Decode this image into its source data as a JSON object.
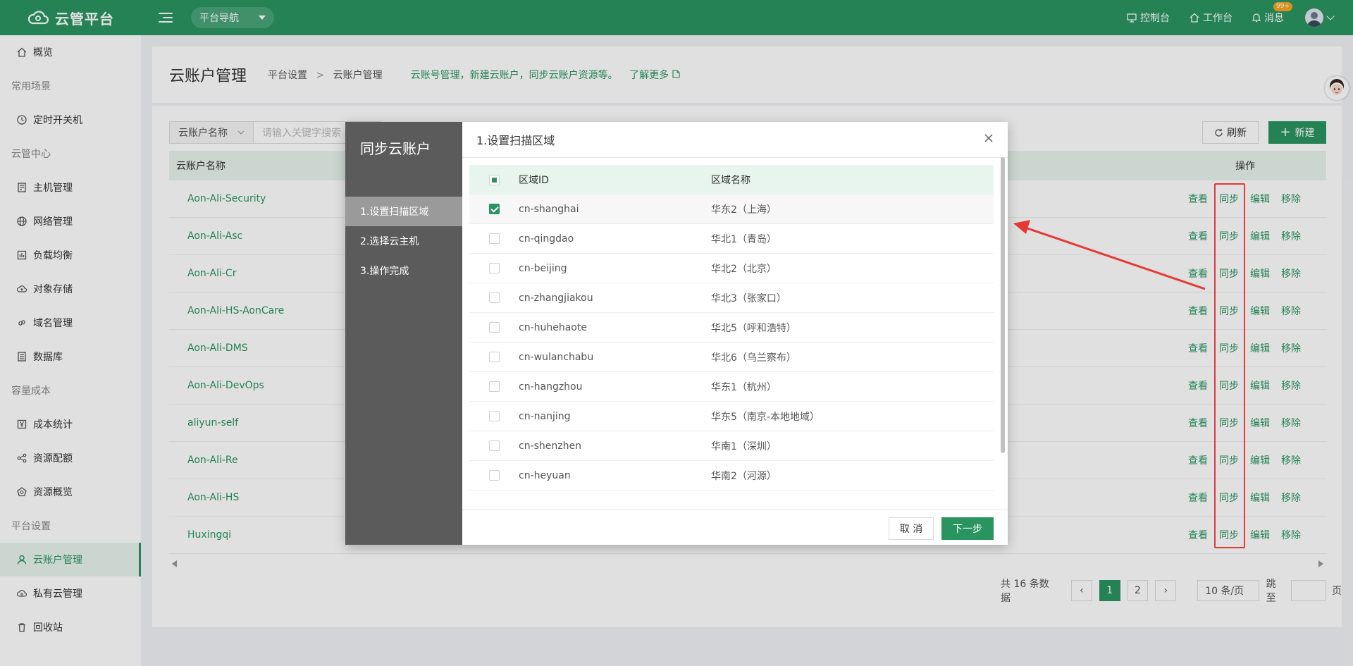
{
  "header": {
    "brand": "云管平台",
    "nav_label": "平台导航",
    "right": [
      {
        "icon": "monitor-icon",
        "label": "控制台"
      },
      {
        "icon": "home-icon",
        "label": "工作台"
      },
      {
        "icon": "bell-icon",
        "label": "消息"
      }
    ],
    "msg_badge": "99+"
  },
  "sidebar": {
    "overview": "概览",
    "group1": "常用场景",
    "timer": "定时开关机",
    "group2": "云管中心",
    "hosts": "主机管理",
    "network": "网络管理",
    "lb": "负载均衡",
    "oss": "对象存储",
    "dns": "域名管理",
    "db": "数据库",
    "group3": "容量成本",
    "cost": "成本统计",
    "quota": "资源配额",
    "res_overview": "资源概览",
    "group4": "平台设置",
    "cloud_account": "云账户管理",
    "private_cloud": "私有云管理",
    "recycle": "回收站"
  },
  "page": {
    "title": "云账户管理",
    "crumb1": "平台设置",
    "crumb_sep": ">",
    "crumb2": "云账户管理",
    "desc": "云账号管理，新建云账户，同步云账户资源等。",
    "more": "了解更多"
  },
  "toolbar": {
    "filter_select": "云账户名称",
    "search_placeholder": "请输入关键字搜索",
    "refresh": "刷新",
    "new": "新建"
  },
  "table": {
    "col_name": "云账户名称",
    "col_op": "操作",
    "rows": [
      "Aon-Ali-Security",
      "Aon-Ali-Asc",
      "Aon-Ali-Cr",
      "Aon-Ali-HS-AonCare",
      "Aon-Ali-DMS",
      "Aon-Ali-DevOps",
      "aliyun-self",
      "Aon-Ali-Re",
      "Aon-Ali-HS",
      "Huxingqi"
    ],
    "ops": {
      "view": "查看",
      "sync": "同步",
      "edit": "编辑",
      "remove": "移除"
    }
  },
  "pager": {
    "total": "共 16 条数据",
    "pages": [
      "1",
      "2"
    ],
    "size": "10 条/页",
    "goto": "跳至",
    "unit": "页"
  },
  "modal": {
    "title": "同步云账户",
    "steps": [
      "1.设置扫描区域",
      "2.选择云主机",
      "3.操作完成"
    ],
    "step_title": "1.设置扫描区域",
    "col_id": "区域ID",
    "col_name": "区域名称",
    "regions": [
      {
        "id": "cn-shanghai",
        "name": "华东2（上海）",
        "checked": true
      },
      {
        "id": "cn-qingdao",
        "name": "华北1（青岛）",
        "checked": false
      },
      {
        "id": "cn-beijing",
        "name": "华北2（北京）",
        "checked": false
      },
      {
        "id": "cn-zhangjiakou",
        "name": "华北3（张家口）",
        "checked": false
      },
      {
        "id": "cn-huhehaote",
        "name": "华北5（呼和浩特）",
        "checked": false
      },
      {
        "id": "cn-wulanchabu",
        "name": "华北6（乌兰察布）",
        "checked": false
      },
      {
        "id": "cn-hangzhou",
        "name": "华东1（杭州）",
        "checked": false
      },
      {
        "id": "cn-nanjing",
        "name": "华东5（南京-本地地域）",
        "checked": false
      },
      {
        "id": "cn-shenzhen",
        "name": "华南1（深圳）",
        "checked": false
      },
      {
        "id": "cn-heyuan",
        "name": "华南2（河源）",
        "checked": false
      }
    ],
    "cancel": "取 消",
    "next": "下一步"
  },
  "colors": {
    "primary": "#2a9461",
    "annotation": "#e53935"
  }
}
